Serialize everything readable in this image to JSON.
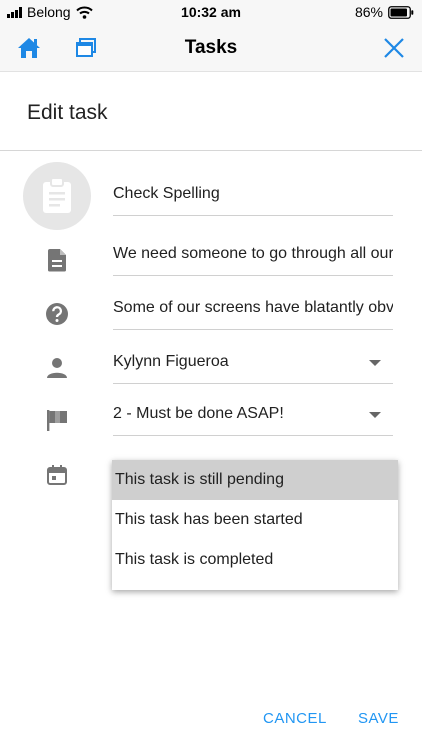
{
  "status_bar": {
    "carrier": "Belong",
    "time": "10:32 am",
    "battery": "86%"
  },
  "nav": {
    "title": "Tasks"
  },
  "page": {
    "title": "Edit task"
  },
  "form": {
    "name": "Check Spelling",
    "description": "We need someone to go through all our",
    "notes": "Some of our screens have blatantly obvi",
    "assignee": "Kylynn Figueroa",
    "priority": "2 - Must be done ASAP!"
  },
  "status_menu": {
    "options": [
      {
        "label": "This task is still pending",
        "selected": true
      },
      {
        "label": "This task has been started",
        "selected": false
      },
      {
        "label": "This task is completed",
        "selected": false
      }
    ]
  },
  "actions": {
    "cancel": "CANCEL",
    "save": "SAVE"
  },
  "colors": {
    "accent": "#2196f3",
    "icon_gray": "#757575",
    "menu_selected": "#cfcfcf"
  },
  "icons": {
    "home": "home-icon",
    "windows": "windows-icon",
    "close": "close-icon",
    "avatar": "clipboard-icon",
    "description": "document-icon",
    "notes": "help-icon",
    "assignee": "person-icon",
    "priority": "flag-icon",
    "status": "calendar-icon"
  }
}
